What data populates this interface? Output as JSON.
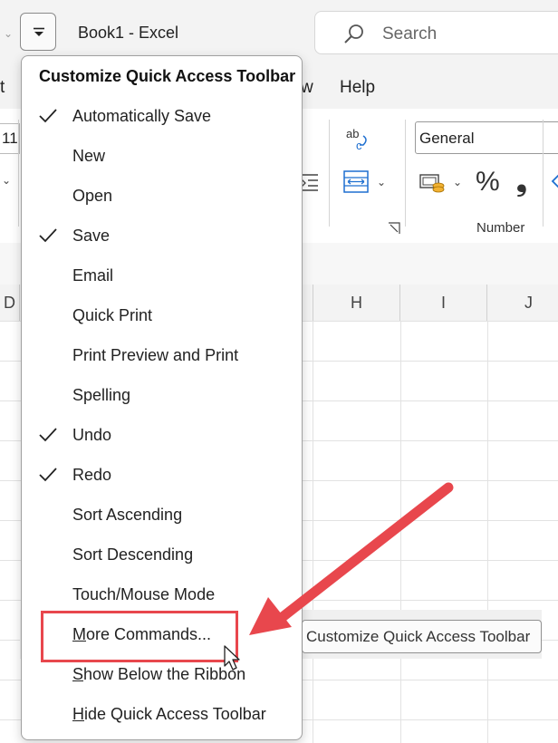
{
  "window": {
    "title": "Book1  -  Excel"
  },
  "search": {
    "placeholder": "Search"
  },
  "ribbon_tabs": [
    {
      "label": "t"
    },
    {
      "label": "w"
    },
    {
      "label": "Help"
    }
  ],
  "ribbon": {
    "font_size_value": "11",
    "number_format_value": "General",
    "number_group_label": "Number",
    "percent_symbol": "%",
    "comma_symbol": "❟"
  },
  "columns": [
    "D",
    "H",
    "I",
    "J"
  ],
  "menu": {
    "title": "Customize Quick Access Toolbar",
    "items": [
      {
        "label": "Automatically Save",
        "checked": true
      },
      {
        "label": "New",
        "checked": false
      },
      {
        "label": "Open",
        "checked": false
      },
      {
        "label": "Save",
        "checked": true
      },
      {
        "label": "Email",
        "checked": false
      },
      {
        "label": "Quick Print",
        "checked": false
      },
      {
        "label": "Print Preview and Print",
        "checked": false
      },
      {
        "label": "Spelling",
        "checked": false
      },
      {
        "label": "Undo",
        "checked": true
      },
      {
        "label": "Redo",
        "checked": true
      },
      {
        "label": "Sort Ascending",
        "checked": false
      },
      {
        "label": "Sort Descending",
        "checked": false
      },
      {
        "label": "Touch/Mouse Mode",
        "checked": false
      },
      {
        "label": "More Commands...",
        "checked": false
      },
      {
        "label": "Show Below the Ribbon",
        "checked": false
      },
      {
        "label": "Hide Quick Access Toolbar",
        "checked": false
      }
    ]
  },
  "tooltip": {
    "text": "Customize Quick Access Toolbar"
  },
  "colors": {
    "annotation_red": "#e8474d",
    "accent_blue": "#1e6fd0"
  }
}
